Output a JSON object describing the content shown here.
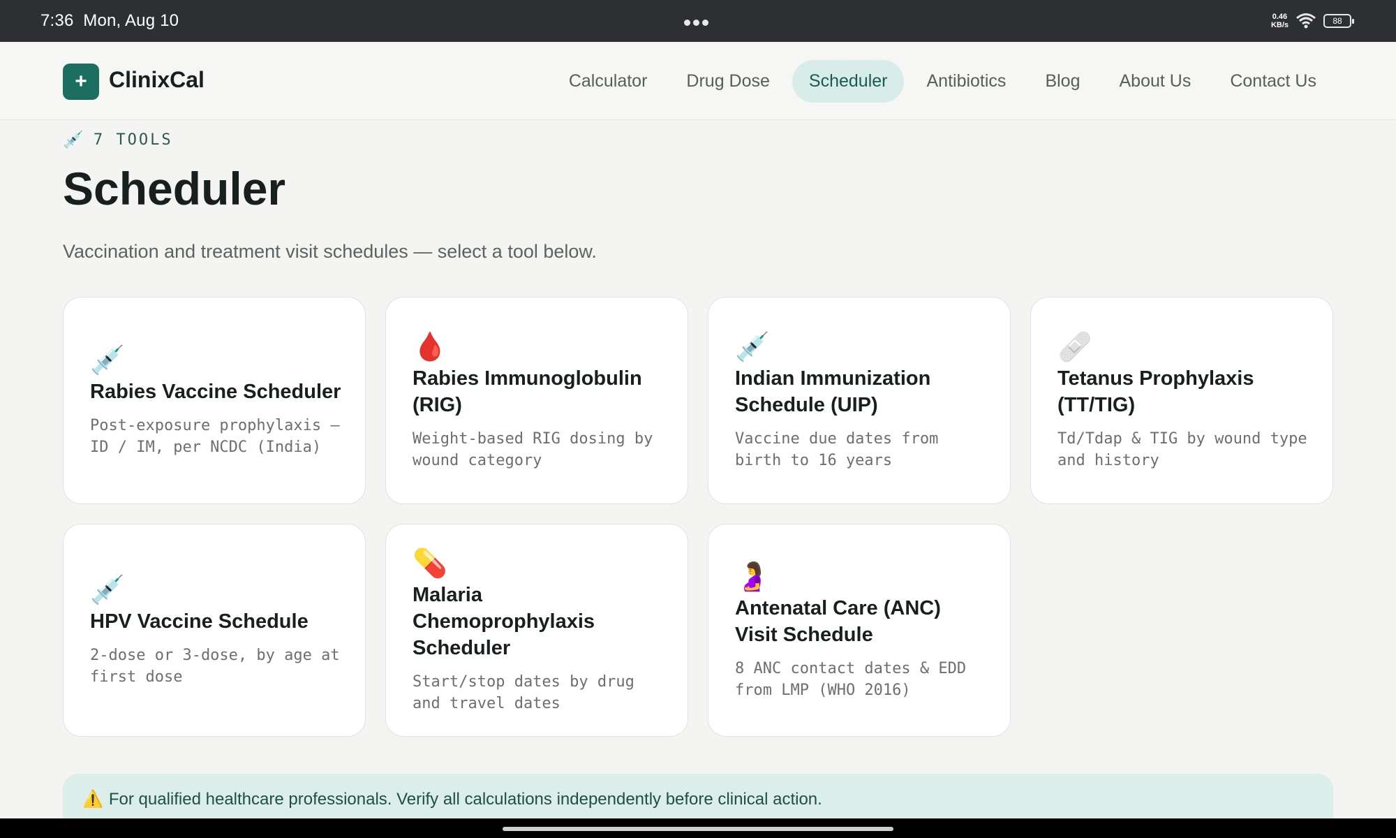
{
  "status_bar": {
    "time": "7:36",
    "date": "Mon, Aug 10",
    "net_speed_value": "0.46",
    "net_speed_unit": "KB/s",
    "battery": "88"
  },
  "header": {
    "logo_symbol": "+",
    "brand": "ClinixCal",
    "nav": [
      {
        "label": "Calculator"
      },
      {
        "label": "Drug Dose"
      },
      {
        "label": "Scheduler",
        "active": true
      },
      {
        "label": "Antibiotics"
      },
      {
        "label": "Blog"
      },
      {
        "label": "About Us"
      },
      {
        "label": "Contact Us"
      }
    ]
  },
  "hero": {
    "eyebrow_icon": "💉",
    "eyebrow": "7 TOOLS",
    "title": "Scheduler",
    "subtitle": "Vaccination and treatment visit schedules — select a tool below."
  },
  "cards": [
    {
      "icon": "💉",
      "icon_name": "syringe-icon",
      "title": "Rabies Vaccine Scheduler",
      "desc": "Post-exposure prophylaxis — ID / IM, per NCDC (India)"
    },
    {
      "icon": "🩸",
      "icon_name": "blood-drop-icon",
      "title": "Rabies Immunoglobulin (RIG)",
      "desc": "Weight-based RIG dosing by wound category"
    },
    {
      "icon": "💉",
      "icon_name": "syringe-icon",
      "title": "Indian Immunization Schedule (UIP)",
      "desc": "Vaccine due dates from birth to 16 years"
    },
    {
      "icon": "🩹",
      "icon_name": "bandage-icon",
      "title": "Tetanus Prophylaxis (TT/TIG)",
      "desc": "Td/Tdap & TIG by wound type and history"
    },
    {
      "icon": "💉",
      "icon_name": "syringe-icon",
      "title": "HPV Vaccine Schedule",
      "desc": "2-dose or 3-dose, by age at first dose"
    },
    {
      "icon": "💊",
      "icon_name": "pill-icon",
      "title": "Malaria Chemoprophylaxis Scheduler",
      "desc": "Start/stop dates by drug and travel dates"
    },
    {
      "icon": "🤰",
      "icon_name": "pregnant-woman-icon",
      "title": "Antenatal Care (ANC) Visit Schedule",
      "desc": "8 ANC contact dates & EDD from LMP (WHO 2016)"
    }
  ],
  "disclaimer": {
    "icon": "⚠️",
    "text": "For qualified healthcare professionals. Verify all calculations independently before clinical action."
  },
  "colors": {
    "brand": "#1b6e60",
    "nav_active_bg": "#d8ecea",
    "disclaimer_bg": "#dceeea",
    "status_bar": "#2d2f33"
  }
}
